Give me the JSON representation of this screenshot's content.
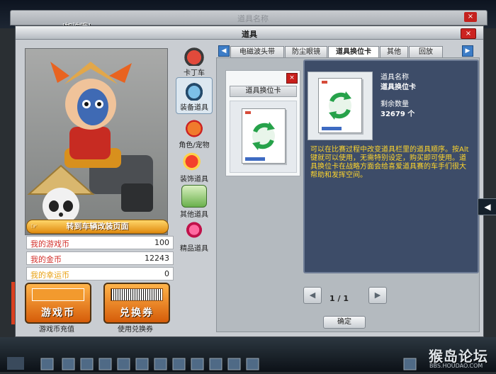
{
  "background": {
    "hint_text": "'加油哦!",
    "window_title": "道具名称"
  },
  "dialog": {
    "title": "道具",
    "close_label": "×"
  },
  "character": {
    "garage_button": "转到车辆改装页面",
    "stats": [
      {
        "label": "我的游戏币",
        "value": "100"
      },
      {
        "label": "我的金币",
        "value": "12243"
      },
      {
        "label": "我的幸运币",
        "value": "0"
      }
    ],
    "buttons": [
      {
        "label": "游戏币",
        "caption": "游戏币充值"
      },
      {
        "label": "兑换券",
        "caption": "使用兑换券"
      }
    ]
  },
  "categories": [
    {
      "label": "卡丁车",
      "icon": "kart-icon"
    },
    {
      "label": "装备道具",
      "icon": "goggles-icon"
    },
    {
      "label": "角色/宠物",
      "icon": "pet-icon"
    },
    {
      "label": "装饰道具",
      "icon": "decoration-icon"
    },
    {
      "label": "其他道具",
      "icon": "gift-box-icon"
    },
    {
      "label": "精品道具",
      "icon": "gem-icon"
    }
  ],
  "tabs": [
    {
      "label": "电磁波头带"
    },
    {
      "label": "防尘眼镜"
    },
    {
      "label": "道具换位卡",
      "active": true
    },
    {
      "label": "其他"
    },
    {
      "label": "回放"
    }
  ],
  "item": {
    "name": "道具换位卡",
    "delete_label": "×"
  },
  "detail": {
    "name_label": "道具名称",
    "name_value": "道具换位卡",
    "qty_label": "剩余数量",
    "qty_value": "32679 个",
    "description": "可以在比赛过程中改变道具栏里的道具顺序。按Alt键就可以使用，无需特别设定，购买即可使用。道具换位卡在战略方面会给喜爱道具赛的车手们很大帮助和发挥空间。"
  },
  "pagination": {
    "text": "1 / 1"
  },
  "ok_label": "确定",
  "watermark": {
    "text": "猴岛论坛",
    "url": "BBS.HOUDAO.COM"
  },
  "colors": {
    "accent_orange": "#e08b10",
    "detail_bg": "#3d4c68",
    "description_text": "#ffd62c",
    "tab_arrow": "#3d7dc7"
  }
}
